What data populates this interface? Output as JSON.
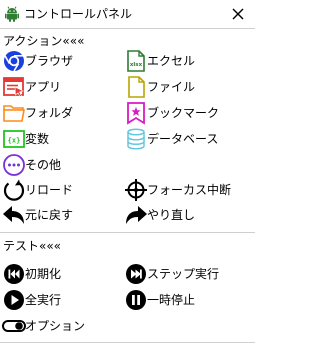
{
  "window": {
    "title": "コントロールパネル"
  },
  "actions": {
    "heading": "アクション«««",
    "browser": "ブラウザ",
    "excel": "エクセル",
    "app": "アプリ",
    "file": "ファイル",
    "folder": "フォルダ",
    "bookmark": "ブックマーク",
    "variable": "変数",
    "database": "データベース",
    "other": "その他",
    "reload": "リロード",
    "focus_center": "フォーカス中断",
    "undo": "元に戻す",
    "redo": "やり直し"
  },
  "test": {
    "heading": "テスト«««",
    "initialize": "初期化",
    "step_run": "ステップ実行",
    "run_all": "全実行",
    "pause": "一時停止",
    "options": "オプション"
  },
  "icons": {
    "app": "android-icon",
    "close": "close-icon",
    "browser": "chrome-icon",
    "excel": "excel-file-icon",
    "apps": "app-window-icon",
    "file": "file-icon",
    "folder": "folder-icon",
    "bookmark": "bookmark-icon",
    "variable": "variable-icon",
    "database": "database-icon",
    "other": "more-icon",
    "reload": "reload-icon",
    "focus": "crosshair-icon",
    "undo": "undo-icon",
    "redo": "redo-icon",
    "initialize": "skip-back-icon",
    "step": "skip-forward-icon",
    "run": "play-icon",
    "pause": "pause-icon",
    "options": "toggle-icon"
  },
  "colors": {
    "browser": "#1a3fdf",
    "excel": "#2e7d32",
    "app": "#e53935",
    "file": "#b9a600",
    "folder": "#ff8c1a",
    "bookmark": "#d81bc4",
    "variable": "#22c422",
    "database": "#67c7dd",
    "other": "#7b2fd9",
    "android": "#2e7d32",
    "divider": "#cfcfcf"
  }
}
